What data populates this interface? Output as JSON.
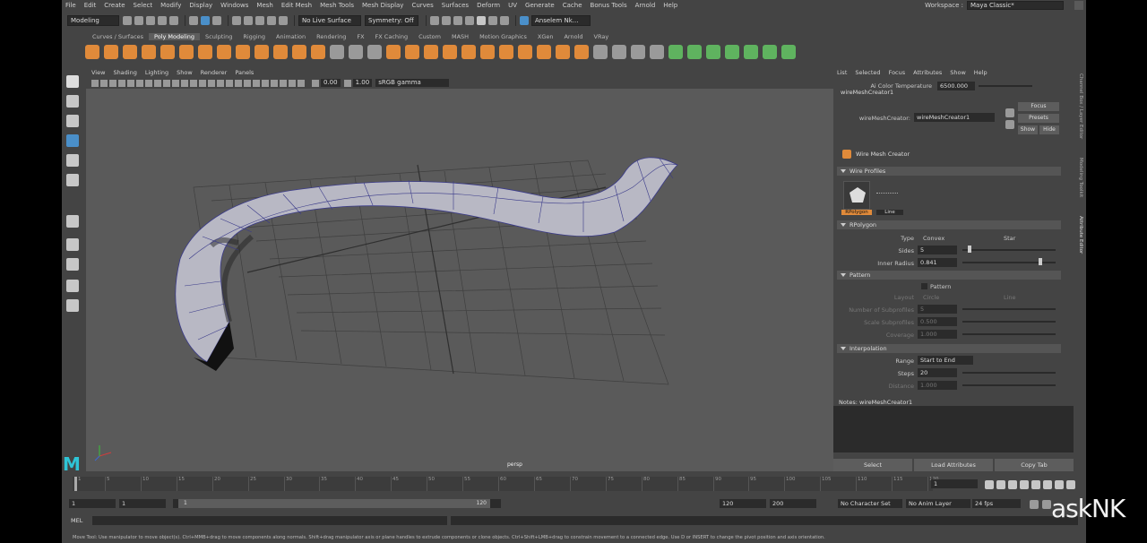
{
  "menubar": {
    "items": [
      "File",
      "Edit",
      "Create",
      "Select",
      "Modify",
      "Display",
      "Windows",
      "Mesh",
      "Edit Mesh",
      "Mesh Tools",
      "Mesh Display",
      "Curves",
      "Surfaces",
      "Deform",
      "UV",
      "Generate",
      "Cache",
      "Bonus Tools",
      "Arnold",
      "Help"
    ],
    "workspace_label": "Workspace :",
    "workspace_value": "Maya Classic*"
  },
  "statusline": {
    "mode": "Modeling",
    "live_surface": "No Live Surface",
    "symmetry": "Symmetry: Off",
    "user": "Anselem Nk..."
  },
  "shelf": {
    "tabs": [
      "Curves / Surfaces",
      "Poly Modeling",
      "Sculpting",
      "Rigging",
      "Animation",
      "Rendering",
      "FX",
      "FX Caching",
      "Custom",
      "MASH",
      "Motion Graphics",
      "XGen",
      "Arnold",
      "VRay"
    ],
    "active_tab": "Poly Modeling"
  },
  "viewport": {
    "menu": [
      "View",
      "Shading",
      "Lighting",
      "Show",
      "Renderer",
      "Panels"
    ],
    "field_1": "0.00",
    "field_2": "1.00",
    "color_space": "sRGB gamma",
    "camera": "persp"
  },
  "attribute_editor": {
    "menu": [
      "List",
      "Selected",
      "Focus",
      "Attributes",
      "Show",
      "Help"
    ],
    "color_temp_label": "Ai Color Temperature",
    "color_temp_value": "6500.000",
    "node_tab": "wireMeshCreator1",
    "node_label": "wireMeshCreator:",
    "node_value": "wireMeshCreator1",
    "focus": "Focus",
    "presets": "Presets",
    "show": "Show",
    "hide": "Hide",
    "title": "Wire Mesh Creator",
    "sections": {
      "wire_profiles": "Wire Profiles",
      "rpolygon": "RPolygon",
      "pattern": "Pattern",
      "interpolation": "Interpolation"
    },
    "profile_1": "RPolygon",
    "profile_2": "Line",
    "type_label": "Type",
    "type_opt1": "Convex",
    "type_opt2": "Star",
    "sides_label": "Sides",
    "sides_value": "5",
    "sides_level": 0.08,
    "inner_label": "Inner Radius",
    "inner_value": "0.841",
    "inner_level": 0.841,
    "pattern_check": "Pattern",
    "layout_label": "Layout",
    "layout_opt1": "Circle",
    "layout_opt2": "Line",
    "num_sub_label": "Number of Subprofiles",
    "num_sub_value": "5",
    "scale_sub_label": "Scale Subprofiles",
    "scale_sub_value": "0.500",
    "coverage_label": "Coverage",
    "coverage_value": "1.000",
    "range_label": "Range",
    "range_value": "Start to End",
    "steps_label": "Steps",
    "steps_value": "20",
    "distance_label": "Distance",
    "distance_value": "1.000",
    "notes_label": "Notes:  wireMeshCreator1",
    "btn_select": "Select",
    "btn_load": "Load Attributes",
    "btn_copy": "Copy Tab"
  },
  "side_tabs": [
    "Channel Box / Layer Editor",
    "Modeling Toolkit",
    "Attribute Editor"
  ],
  "timeline": {
    "ticks": [
      "1",
      "5",
      "10",
      "15",
      "20",
      "25",
      "30",
      "35",
      "40",
      "45",
      "50",
      "55",
      "60",
      "65",
      "70",
      "75",
      "80",
      "85",
      "90",
      "95",
      "100",
      "105",
      "110",
      "115",
      "120"
    ],
    "current_frame": "1"
  },
  "range": {
    "start": "1",
    "start_inner": "1",
    "slider_start": "1",
    "slider_end": "120",
    "end_inner": "120",
    "end": "200",
    "character_set": "No Character Set",
    "anim_layer": "No Anim Layer",
    "fps": "24 fps"
  },
  "command_line": {
    "label": "MEL"
  },
  "help_line": "Move Tool: Use manipulator to move object(s). Ctrl+MMB+drag to move components along normals. Shift+drag manipulator axis or plane handles to extrude components or clone objects. Ctrl+Shift+LMB+drag to constrain movement to a connected edge. Use D or INSERT to change the pivot position and axis orientation.",
  "watermark": "askNK",
  "logo": "M"
}
